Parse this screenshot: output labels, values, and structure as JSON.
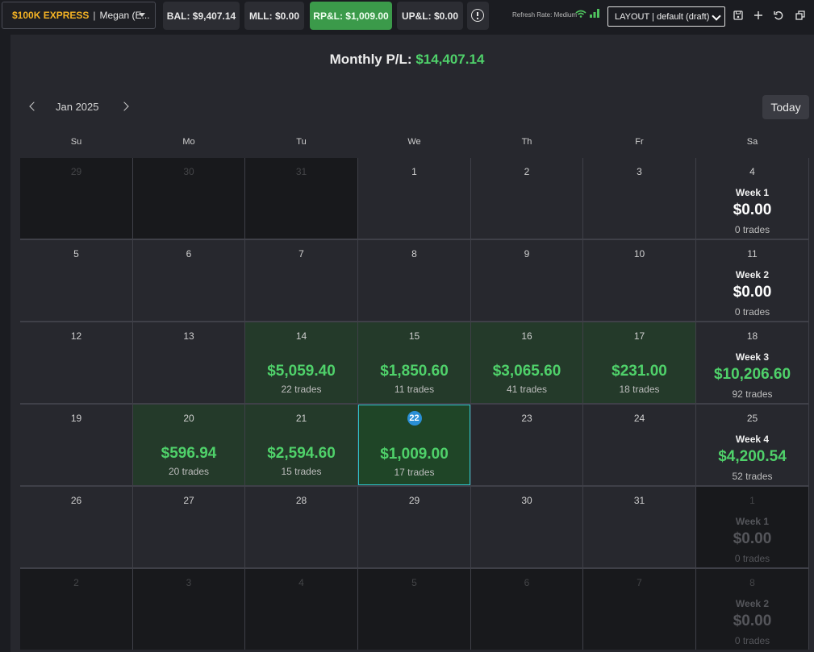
{
  "topbar": {
    "account_badge": "$100K EXPRESS",
    "separator": "|",
    "account_user": "Megan (E...",
    "balance": "BAL: $9,407.14",
    "mll": "MLL: $0.00",
    "rpl": "RP&L: $1,009.00",
    "upl": "UP&L: $0.00",
    "refresh_rate": "Refresh Rate: Medium",
    "layout_select": "LAYOUT | default (draft)",
    "icons": [
      "alert-icon",
      "wifi-icon",
      "signal-bars-icon",
      "save-icon",
      "plus-icon",
      "undo-icon",
      "windows-icon"
    ],
    "colors": {
      "express": "#f5b324",
      "rpl_bg": "#3b9a4a"
    }
  },
  "calendar": {
    "monthly_label": "Monthly P/L:",
    "monthly_value": "$14,407.14",
    "month": "Jan 2025",
    "today_button": "Today",
    "days_of_week": [
      "Su",
      "Mo",
      "Tu",
      "We",
      "Th",
      "Fr",
      "Sa"
    ],
    "positive_color": "#4fd16a",
    "weeks": [
      {
        "days": [
          {
            "n": "29",
            "out": true
          },
          {
            "n": "30",
            "out": true
          },
          {
            "n": "31",
            "out": true
          },
          {
            "n": "1"
          },
          {
            "n": "2"
          },
          {
            "n": "3"
          }
        ],
        "sat": {
          "n": "4",
          "label": "Week 1",
          "value": "$0.00",
          "trades": "0 trades"
        }
      },
      {
        "days": [
          {
            "n": "5"
          },
          {
            "n": "6"
          },
          {
            "n": "7"
          },
          {
            "n": "8"
          },
          {
            "n": "9"
          },
          {
            "n": "10"
          }
        ],
        "sat": {
          "n": "11",
          "label": "Week 2",
          "value": "$0.00",
          "trades": "0 trades"
        }
      },
      {
        "days": [
          {
            "n": "12"
          },
          {
            "n": "13"
          },
          {
            "n": "14",
            "pl": "$5,059.40",
            "trades": "22 trades"
          },
          {
            "n": "15",
            "pl": "$1,850.60",
            "trades": "11 trades"
          },
          {
            "n": "16",
            "pl": "$3,065.60",
            "trades": "41 trades"
          },
          {
            "n": "17",
            "pl": "$231.00",
            "trades": "18 trades"
          }
        ],
        "sat": {
          "n": "18",
          "label": "Week 3",
          "value": "$10,206.60",
          "trades": "92 trades",
          "positive": true
        }
      },
      {
        "days": [
          {
            "n": "19"
          },
          {
            "n": "20",
            "pl": "$596.94",
            "trades": "20 trades"
          },
          {
            "n": "21",
            "pl": "$2,594.60",
            "trades": "15 trades"
          },
          {
            "n": "22",
            "pl": "$1,009.00",
            "trades": "17 trades",
            "today": true
          },
          {
            "n": "23"
          },
          {
            "n": "24"
          }
        ],
        "sat": {
          "n": "25",
          "label": "Week 4",
          "value": "$4,200.54",
          "trades": "52 trades",
          "positive": true
        }
      },
      {
        "days": [
          {
            "n": "26"
          },
          {
            "n": "27"
          },
          {
            "n": "28"
          },
          {
            "n": "29"
          },
          {
            "n": "30"
          },
          {
            "n": "31"
          }
        ],
        "sat": {
          "n": "1",
          "label": "Week 1",
          "value": "$0.00",
          "trades": "0 trades",
          "out": true
        }
      },
      {
        "days": [
          {
            "n": "2",
            "out": true
          },
          {
            "n": "3",
            "out": true
          },
          {
            "n": "4",
            "out": true
          },
          {
            "n": "5",
            "out": true
          },
          {
            "n": "6",
            "out": true
          },
          {
            "n": "7",
            "out": true
          }
        ],
        "sat": {
          "n": "8",
          "label": "Week 2",
          "value": "$0.00",
          "trades": "0 trades",
          "out": true
        }
      }
    ]
  }
}
